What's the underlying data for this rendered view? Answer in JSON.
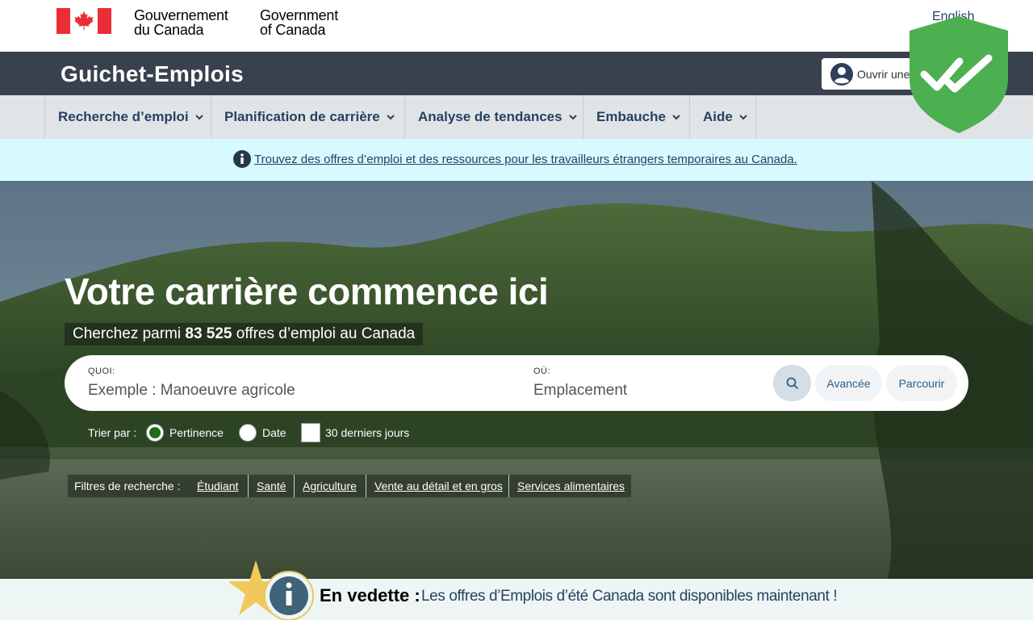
{
  "header": {
    "gov_fr_line1": "Gouvernement",
    "gov_fr_line2": "du Canada",
    "gov_en_line1": "Government",
    "gov_en_line2": "of Canada",
    "language_link": "English"
  },
  "appbar": {
    "title": "Guichet-Emplois",
    "signin_label": "Ouvrir une session"
  },
  "menu": {
    "items": [
      {
        "label": "Recherche d’emploi"
      },
      {
        "label": "Planification de carrière"
      },
      {
        "label": "Analyse de tendances"
      },
      {
        "label": "Embauche"
      },
      {
        "label": "Aide"
      }
    ]
  },
  "notice": {
    "text": "Trouvez des offres d’emploi et des ressources pour les travailleurs étrangers temporaires au Canada.",
    "icon": "info-icon"
  },
  "hero": {
    "title": "Votre carrière commence ici",
    "subtitle_prefix": "Cherchez parmi ",
    "job_count": "83 525",
    "subtitle_suffix": " offres d’emploi au Canada"
  },
  "search": {
    "what_label": "QUOI:",
    "what_placeholder": "Exemple : Manoeuvre agricole",
    "where_label": "OÙ:",
    "where_placeholder": "Emplacement",
    "advanced_label": "Avancée",
    "browse_label": "Parcourir"
  },
  "sort": {
    "label": "Trier par :",
    "options": [
      {
        "label": "Pertinence",
        "selected": true
      },
      {
        "label": "Date",
        "selected": false
      }
    ],
    "recent_label": "30 derniers jours",
    "recent_checked": false
  },
  "filters": {
    "label": "Filtres de recherche :",
    "links": [
      "Étudiant",
      "Santé",
      "Agriculture",
      "Vente au détail et en gros",
      "Services alimentaires"
    ]
  },
  "featured": {
    "label": "En vedette :",
    "text": "Les offres d’Emplois d’été Canada sont disponibles maintenant !"
  },
  "colors": {
    "appbar": "#38414d",
    "menu_bg": "#e1e4e7",
    "link": "#284162",
    "notice_bg": "#d7faff",
    "shield": "#4caf50",
    "flag_red": "#eb2d37"
  }
}
